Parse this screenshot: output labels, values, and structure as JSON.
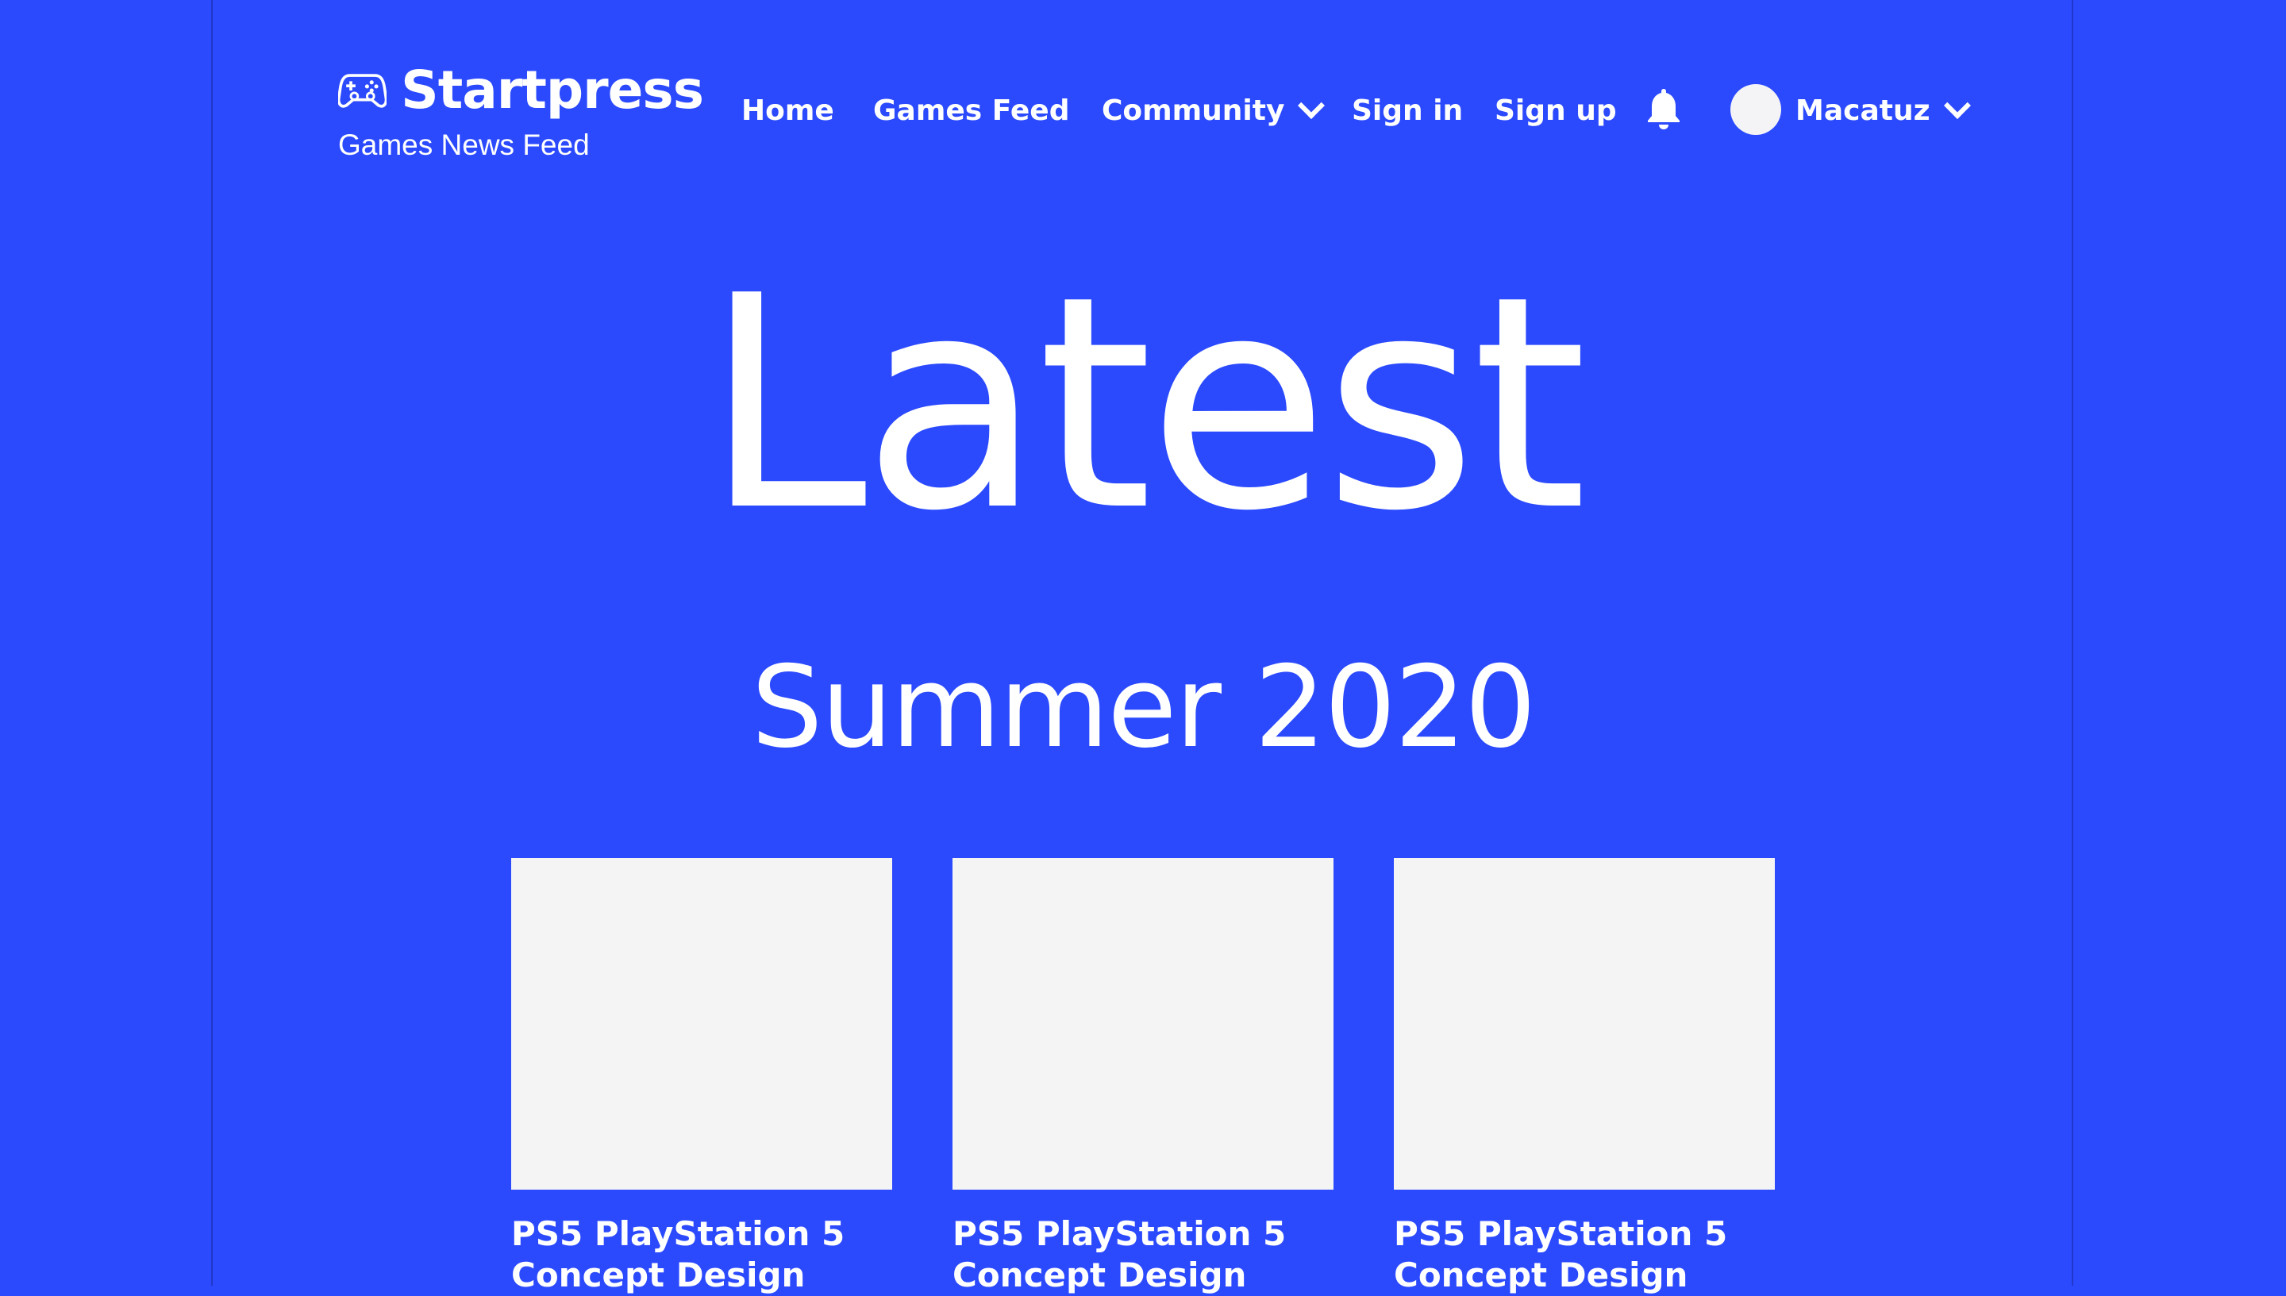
{
  "brand": {
    "name": "Startpress",
    "tagline": "Games News Feed",
    "logo_icon": "gamepad-icon"
  },
  "nav": {
    "home": "Home",
    "games_feed": "Games Feed",
    "community": "Community",
    "sign_in": "Sign in",
    "sign_up": "Sign up",
    "notifications_icon": "bell-icon",
    "user_name": "Macatuz"
  },
  "hero": {
    "title": "Latest",
    "subtitle": "Summer 2020"
  },
  "cards": [
    {
      "title": "PS5 PlayStation 5 Concept Design"
    },
    {
      "title": "PS5 PlayStation 5 Concept Design"
    },
    {
      "title": "PS5 PlayStation 5 Concept Design"
    }
  ],
  "colors": {
    "background": "#2b4afe",
    "text": "#ffffff",
    "placeholder": "#f4f4f4"
  }
}
